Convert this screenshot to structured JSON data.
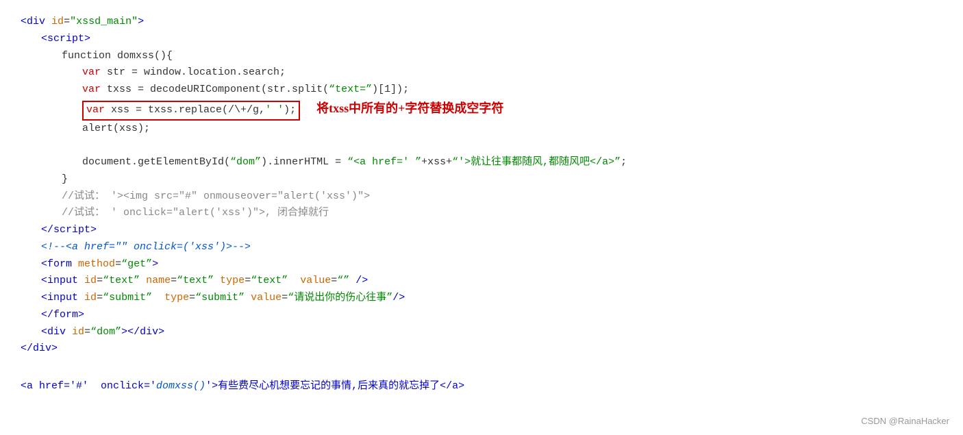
{
  "watermark": "CSDN @RainaHacker",
  "annotation": "将txss中所有的+字符替换成空字符",
  "lines": [
    {
      "indent": 0,
      "parts": [
        {
          "t": "<",
          "c": "tag-blue"
        },
        {
          "t": "div",
          "c": "tag-blue"
        },
        {
          "t": " ",
          "c": "plain"
        },
        {
          "t": "id",
          "c": "attr"
        },
        {
          "t": "=",
          "c": "plain"
        },
        {
          "t": "\"xssd_main\"",
          "c": "string"
        },
        {
          "t": ">",
          "c": "tag-blue"
        }
      ]
    },
    {
      "indent": 1,
      "parts": [
        {
          "t": "<",
          "c": "tag-blue"
        },
        {
          "t": "script",
          "c": "tag-blue"
        },
        {
          "t": ">",
          "c": "tag-blue"
        }
      ]
    },
    {
      "indent": 2,
      "parts": [
        {
          "t": "function domxss(){",
          "c": "plain"
        }
      ]
    },
    {
      "indent": 3,
      "parts": [
        {
          "t": "var",
          "c": "c-red"
        },
        {
          "t": " str = window.location.search;",
          "c": "plain"
        }
      ]
    },
    {
      "indent": 3,
      "parts": [
        {
          "t": "var",
          "c": "c-red"
        },
        {
          "t": " txss = decodeURIComponent(str.split(",
          "c": "plain"
        },
        {
          "t": "“text=”",
          "c": "string"
        },
        {
          "t": ")[1]);",
          "c": "plain"
        }
      ]
    },
    {
      "indent": 3,
      "highlight": true,
      "parts": [
        {
          "t": "var",
          "c": "c-red"
        },
        {
          "t": " xss = txss.replace(/\\+/g,",
          "c": "plain"
        },
        {
          "t": "' '",
          "c": "string"
        },
        {
          "t": ");",
          "c": "plain"
        }
      ]
    },
    {
      "indent": 3,
      "parts": [
        {
          "t": "alert(xss);",
          "c": "plain"
        }
      ]
    },
    {
      "indent": 0,
      "parts": []
    },
    {
      "indent": 3,
      "parts": [
        {
          "t": "document.getElementById(",
          "c": "plain"
        },
        {
          "t": "“dom”",
          "c": "string"
        },
        {
          "t": ").innerHTML = ",
          "c": "plain"
        },
        {
          "t": "“<a href=' ”",
          "c": "string"
        },
        {
          "t": "+xss+",
          "c": "plain"
        },
        {
          "t": "“'>就让往事都随风,都随风吧</a>”",
          "c": "string"
        },
        {
          "t": ";",
          "c": "plain"
        }
      ]
    },
    {
      "indent": 2,
      "parts": [
        {
          "t": "}",
          "c": "plain"
        }
      ]
    },
    {
      "indent": 2,
      "parts": [
        {
          "t": "//试试： '><img src=\"#\" onmouseover=\"alert('xss')\">",
          "c": "comment"
        }
      ]
    },
    {
      "indent": 2,
      "parts": [
        {
          "t": "//试试： ' onclick=\"alert('xss')\">, 闭合掉就行",
          "c": "comment"
        }
      ]
    },
    {
      "indent": 1,
      "parts": [
        {
          "t": "</",
          "c": "tag-blue"
        },
        {
          "t": "script",
          "c": "tag-blue"
        },
        {
          "t": ">",
          "c": "tag-blue"
        }
      ]
    },
    {
      "indent": 1,
      "italic": true,
      "parts": [
        {
          "t": "<!--<a href=\"\" onclick=('xss')>-->",
          "c": "italic-blue"
        }
      ]
    },
    {
      "indent": 1,
      "parts": [
        {
          "t": "<",
          "c": "tag-blue"
        },
        {
          "t": "form",
          "c": "tag-blue"
        },
        {
          "t": " ",
          "c": "plain"
        },
        {
          "t": "method",
          "c": "attr"
        },
        {
          "t": "=",
          "c": "plain"
        },
        {
          "t": "“get”",
          "c": "string"
        },
        {
          "t": ">",
          "c": "tag-blue"
        }
      ]
    },
    {
      "indent": 1,
      "parts": [
        {
          "t": "<",
          "c": "tag-blue"
        },
        {
          "t": "input",
          "c": "tag-blue"
        },
        {
          "t": " ",
          "c": "plain"
        },
        {
          "t": "id",
          "c": "attr"
        },
        {
          "t": "=",
          "c": "plain"
        },
        {
          "t": "“text”",
          "c": "string"
        },
        {
          "t": " ",
          "c": "plain"
        },
        {
          "t": "name",
          "c": "attr"
        },
        {
          "t": "=",
          "c": "plain"
        },
        {
          "t": "“text”",
          "c": "string"
        },
        {
          "t": " ",
          "c": "plain"
        },
        {
          "t": "type",
          "c": "attr"
        },
        {
          "t": "=",
          "c": "plain"
        },
        {
          "t": "“text”",
          "c": "string"
        },
        {
          "t": "  ",
          "c": "plain"
        },
        {
          "t": "value",
          "c": "attr"
        },
        {
          "t": "=",
          "c": "plain"
        },
        {
          "t": "“”",
          "c": "string"
        },
        {
          "t": " />",
          "c": "tag-blue"
        }
      ]
    },
    {
      "indent": 1,
      "parts": [
        {
          "t": "<",
          "c": "tag-blue"
        },
        {
          "t": "input",
          "c": "tag-blue"
        },
        {
          "t": " ",
          "c": "plain"
        },
        {
          "t": "id",
          "c": "attr"
        },
        {
          "t": "=",
          "c": "plain"
        },
        {
          "t": "“submit”",
          "c": "string"
        },
        {
          "t": "  ",
          "c": "plain"
        },
        {
          "t": "type",
          "c": "attr"
        },
        {
          "t": "=",
          "c": "plain"
        },
        {
          "t": "“submit”",
          "c": "string"
        },
        {
          "t": " ",
          "c": "plain"
        },
        {
          "t": "value",
          "c": "attr"
        },
        {
          "t": "=",
          "c": "plain"
        },
        {
          "t": "“请说出你的伤心往事”",
          "c": "string"
        },
        {
          "t": "/>",
          "c": "tag-blue"
        }
      ]
    },
    {
      "indent": 1,
      "parts": [
        {
          "t": "</",
          "c": "tag-blue"
        },
        {
          "t": "form",
          "c": "tag-blue"
        },
        {
          "t": ">",
          "c": "tag-blue"
        }
      ]
    },
    {
      "indent": 1,
      "parts": [
        {
          "t": "<",
          "c": "tag-blue"
        },
        {
          "t": "div",
          "c": "tag-blue"
        },
        {
          "t": " ",
          "c": "plain"
        },
        {
          "t": "id",
          "c": "attr"
        },
        {
          "t": "=",
          "c": "plain"
        },
        {
          "t": "“dom”",
          "c": "string"
        },
        {
          "t": "></",
          "c": "tag-blue"
        },
        {
          "t": "div",
          "c": "tag-blue"
        },
        {
          "t": ">",
          "c": "tag-blue"
        }
      ]
    },
    {
      "indent": 0,
      "parts": [
        {
          "t": "</",
          "c": "tag-blue"
        },
        {
          "t": "div",
          "c": "tag-blue"
        },
        {
          "t": ">",
          "c": "tag-blue"
        }
      ]
    }
  ],
  "bottom_line": {
    "pre": "<a href='#'  onclick='",
    "link": "domxss()",
    "post": "'>有些费尽心机想要忘记的事情,后来真的就忘掉了</a>"
  }
}
